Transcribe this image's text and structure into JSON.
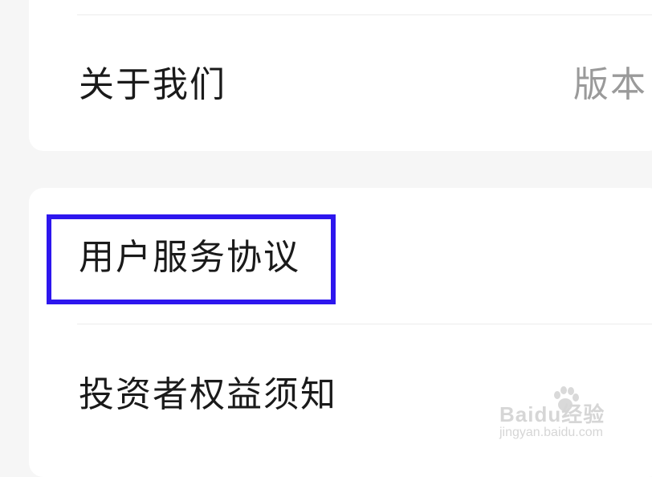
{
  "rows": {
    "about_us": {
      "label": "关于我们",
      "value": "版本"
    },
    "user_agreement": {
      "label": "用户服务协议"
    },
    "investor_rights": {
      "label": "投资者权益须知"
    }
  },
  "watermark": {
    "logo_text": "Baidu经验",
    "url": "jingyan.baidu.com"
  },
  "colors": {
    "highlight": "#2d16ee",
    "background": "#f6f6f6",
    "card": "#ffffff"
  }
}
